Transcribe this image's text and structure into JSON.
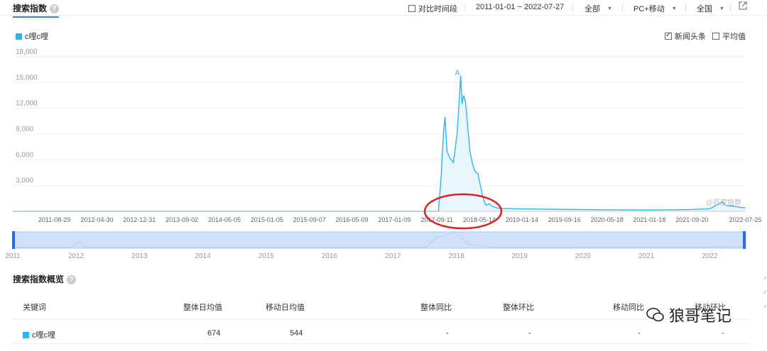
{
  "header": {
    "title": "搜索指数",
    "compare_label": "对比时间段",
    "date_range": "2011-01-01 ~ 2022-07-27",
    "source_select": "全部",
    "device_select": "PC+移动",
    "region_select": "全国"
  },
  "legend": {
    "keyword": "c哩c哩",
    "color": "#2cb7ef"
  },
  "options": {
    "news_label": "新闻头条",
    "news_checked": true,
    "avg_label": "平均值",
    "avg_checked": false
  },
  "chart_data": {
    "type": "area",
    "series": [
      {
        "name": "c哩c哩"
      }
    ],
    "y_ticks": [
      "3,000",
      "6,000",
      "9,000",
      "12,000",
      "15,000",
      "18,000"
    ],
    "ylim": [
      0,
      18000
    ],
    "x_ticks": [
      "2011-08-29",
      "2012-04-30",
      "2012-12-31",
      "2013-09-02",
      "2014-05-05",
      "2015-01-05",
      "2015-09-07",
      "2016-05-09",
      "2017-01-09",
      "2017-09-11",
      "2018-05-14",
      "2019-01-14",
      "2019-09-16",
      "2020-05-18",
      "2021-01-18",
      "2021-09-20",
      "2022-07-25"
    ],
    "points": [
      [
        "2011-01-01",
        0
      ],
      [
        "2017-09-20",
        0
      ],
      [
        "2017-10-05",
        4000
      ],
      [
        "2017-10-20",
        9500
      ],
      [
        "2017-10-28",
        11000
      ],
      [
        "2017-11-08",
        7000
      ],
      [
        "2017-11-25",
        6200
      ],
      [
        "2017-12-15",
        5700
      ],
      [
        "2018-01-05",
        9000
      ],
      [
        "2018-01-18",
        13000
      ],
      [
        "2018-01-26",
        15800
      ],
      [
        "2018-02-03",
        12500
      ],
      [
        "2018-02-12",
        13500
      ],
      [
        "2018-02-22",
        12800
      ],
      [
        "2018-03-05",
        10500
      ],
      [
        "2018-03-20",
        7000
      ],
      [
        "2018-04-05",
        5500
      ],
      [
        "2018-04-20",
        4600
      ],
      [
        "2018-05-05",
        4400
      ],
      [
        "2018-05-20",
        3000
      ],
      [
        "2018-06-05",
        1500
      ],
      [
        "2018-06-20",
        700
      ],
      [
        "2018-07-10",
        900
      ],
      [
        "2018-07-25",
        600
      ],
      [
        "2018-09-01",
        350
      ],
      [
        "2018-12-01",
        300
      ],
      [
        "2019-06-01",
        250
      ],
      [
        "2020-01-01",
        200
      ],
      [
        "2021-01-01",
        150
      ],
      [
        "2021-09-01",
        200
      ],
      [
        "2022-01-01",
        300
      ],
      [
        "2022-03-15",
        1100
      ],
      [
        "2022-04-01",
        700
      ],
      [
        "2022-07-25",
        400
      ]
    ],
    "peak_marker": "A",
    "watermark": "@百度指数",
    "grid": true,
    "annotation": "red ellipse around 2018-05-14"
  },
  "range_slider": {
    "years": [
      "2011",
      "2012",
      "2013",
      "2014",
      "2015",
      "2016",
      "2017",
      "2018",
      "2019",
      "2020",
      "2021",
      "2022"
    ]
  },
  "overview": {
    "title": "搜索指数概览",
    "headers": [
      "关键词",
      "整体日均值",
      "移动日均值",
      "整体同比",
      "整体环比",
      "移动同比",
      "移动环比"
    ],
    "rows": [
      {
        "keyword": "c哩c哩",
        "overall_avg": "674",
        "mobile_avg": "544",
        "overall_yoy": "-",
        "overall_mom": "-",
        "mobile_yoy": "-",
        "mobile_mom": "-"
      }
    ]
  },
  "watermark_text": "狼哥笔记"
}
